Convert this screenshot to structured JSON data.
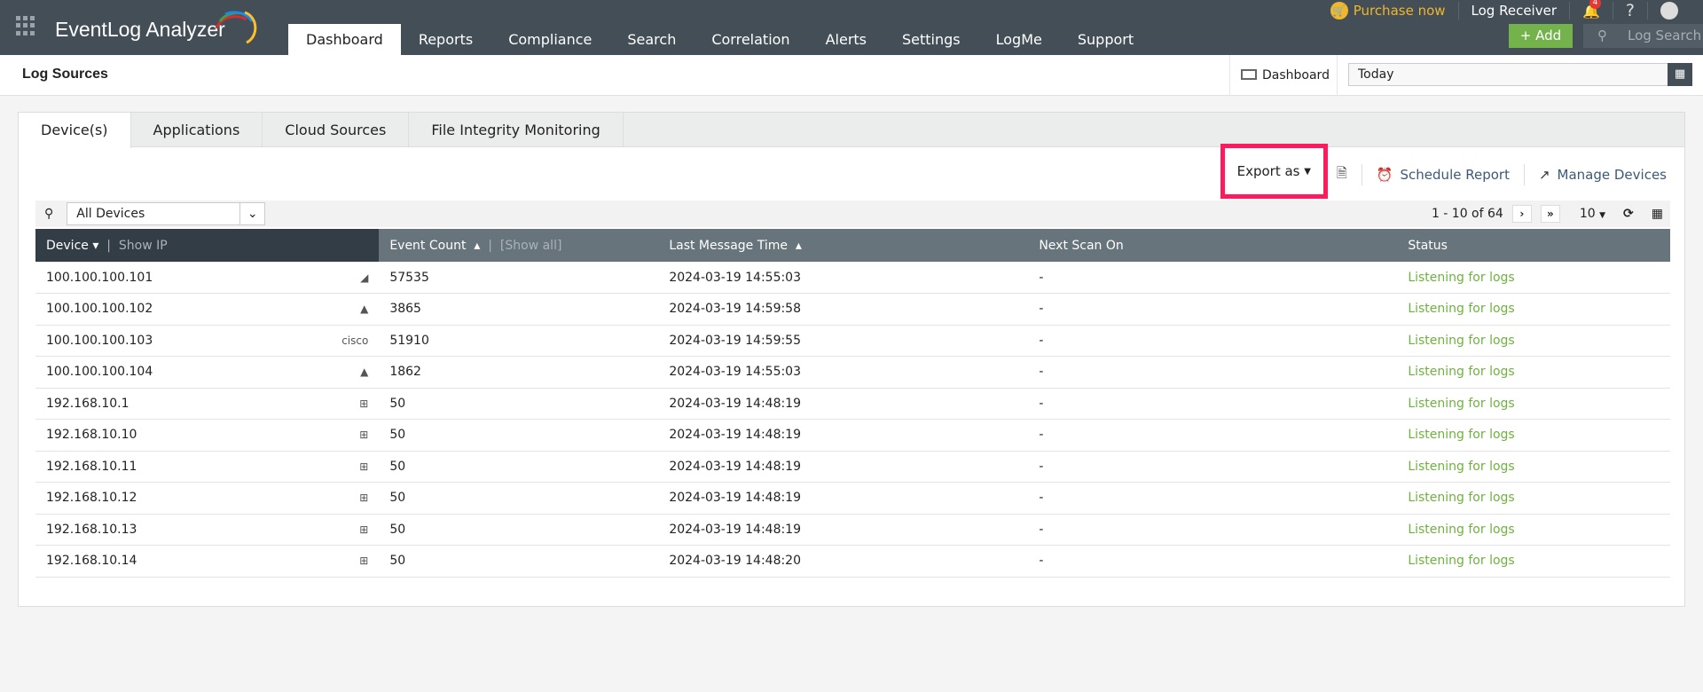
{
  "app": {
    "title": "EventLog Analyzer",
    "logo_colors": [
      "#d32f2f",
      "#43a047",
      "#1e88e5",
      "#fbc02d"
    ]
  },
  "nav": [
    {
      "label": "Dashboard",
      "active": true
    },
    {
      "label": "Reports"
    },
    {
      "label": "Compliance"
    },
    {
      "label": "Search"
    },
    {
      "label": "Correlation"
    },
    {
      "label": "Alerts"
    },
    {
      "label": "Settings"
    },
    {
      "label": "LogMe"
    },
    {
      "label": "Support"
    }
  ],
  "topbar": {
    "purchase": "Purchase now",
    "log_receiver": "Log Receiver",
    "notifications": "4",
    "help": "?",
    "add": "+ Add",
    "log_search": "Log Search"
  },
  "subheader": {
    "title": "Log Sources",
    "dashboard_link": "Dashboard",
    "date_range": "Today"
  },
  "tabs": [
    {
      "label": "Device(s)",
      "active": true
    },
    {
      "label": "Applications"
    },
    {
      "label": "Cloud Sources"
    },
    {
      "label": "File Integrity Monitoring"
    }
  ],
  "toolbar": {
    "export": "Export as",
    "schedule": "Schedule Report",
    "manage": "Manage Devices"
  },
  "filter": {
    "device_filter": "All Devices",
    "pagination": "1 - 10 of 64",
    "page_size": "10"
  },
  "table": {
    "headers": {
      "device": "Device",
      "show_ip": "Show IP",
      "event_count": "Event Count",
      "show_all": "[Show all]",
      "last_message": "Last Message Time",
      "next_scan": "Next Scan On",
      "status": "Status"
    },
    "rows": [
      {
        "device": "100.100.100.101",
        "os": "generic",
        "events": "57535",
        "last": "2024-03-19 14:55:03",
        "next": "-",
        "status": "Listening for logs"
      },
      {
        "device": "100.100.100.102",
        "os": "linux",
        "events": "3865",
        "last": "2024-03-19 14:59:58",
        "next": "-",
        "status": "Listening for logs"
      },
      {
        "device": "100.100.100.103",
        "os": "cisco",
        "events": "51910",
        "last": "2024-03-19 14:59:55",
        "next": "-",
        "status": "Listening for logs"
      },
      {
        "device": "100.100.100.104",
        "os": "linux",
        "events": "1862",
        "last": "2024-03-19 14:55:03",
        "next": "-",
        "status": "Listening for logs"
      },
      {
        "device": "192.168.10.1",
        "os": "windows",
        "events": "50",
        "last": "2024-03-19 14:48:19",
        "next": "-",
        "status": "Listening for logs"
      },
      {
        "device": "192.168.10.10",
        "os": "windows",
        "events": "50",
        "last": "2024-03-19 14:48:19",
        "next": "-",
        "status": "Listening for logs"
      },
      {
        "device": "192.168.10.11",
        "os": "windows",
        "events": "50",
        "last": "2024-03-19 14:48:19",
        "next": "-",
        "status": "Listening for logs"
      },
      {
        "device": "192.168.10.12",
        "os": "windows",
        "events": "50",
        "last": "2024-03-19 14:48:19",
        "next": "-",
        "status": "Listening for logs"
      },
      {
        "device": "192.168.10.13",
        "os": "windows",
        "events": "50",
        "last": "2024-03-19 14:48:19",
        "next": "-",
        "status": "Listening for logs"
      },
      {
        "device": "192.168.10.14",
        "os": "windows",
        "events": "50",
        "last": "2024-03-19 14:48:20",
        "next": "-",
        "status": "Listening for logs"
      }
    ]
  }
}
